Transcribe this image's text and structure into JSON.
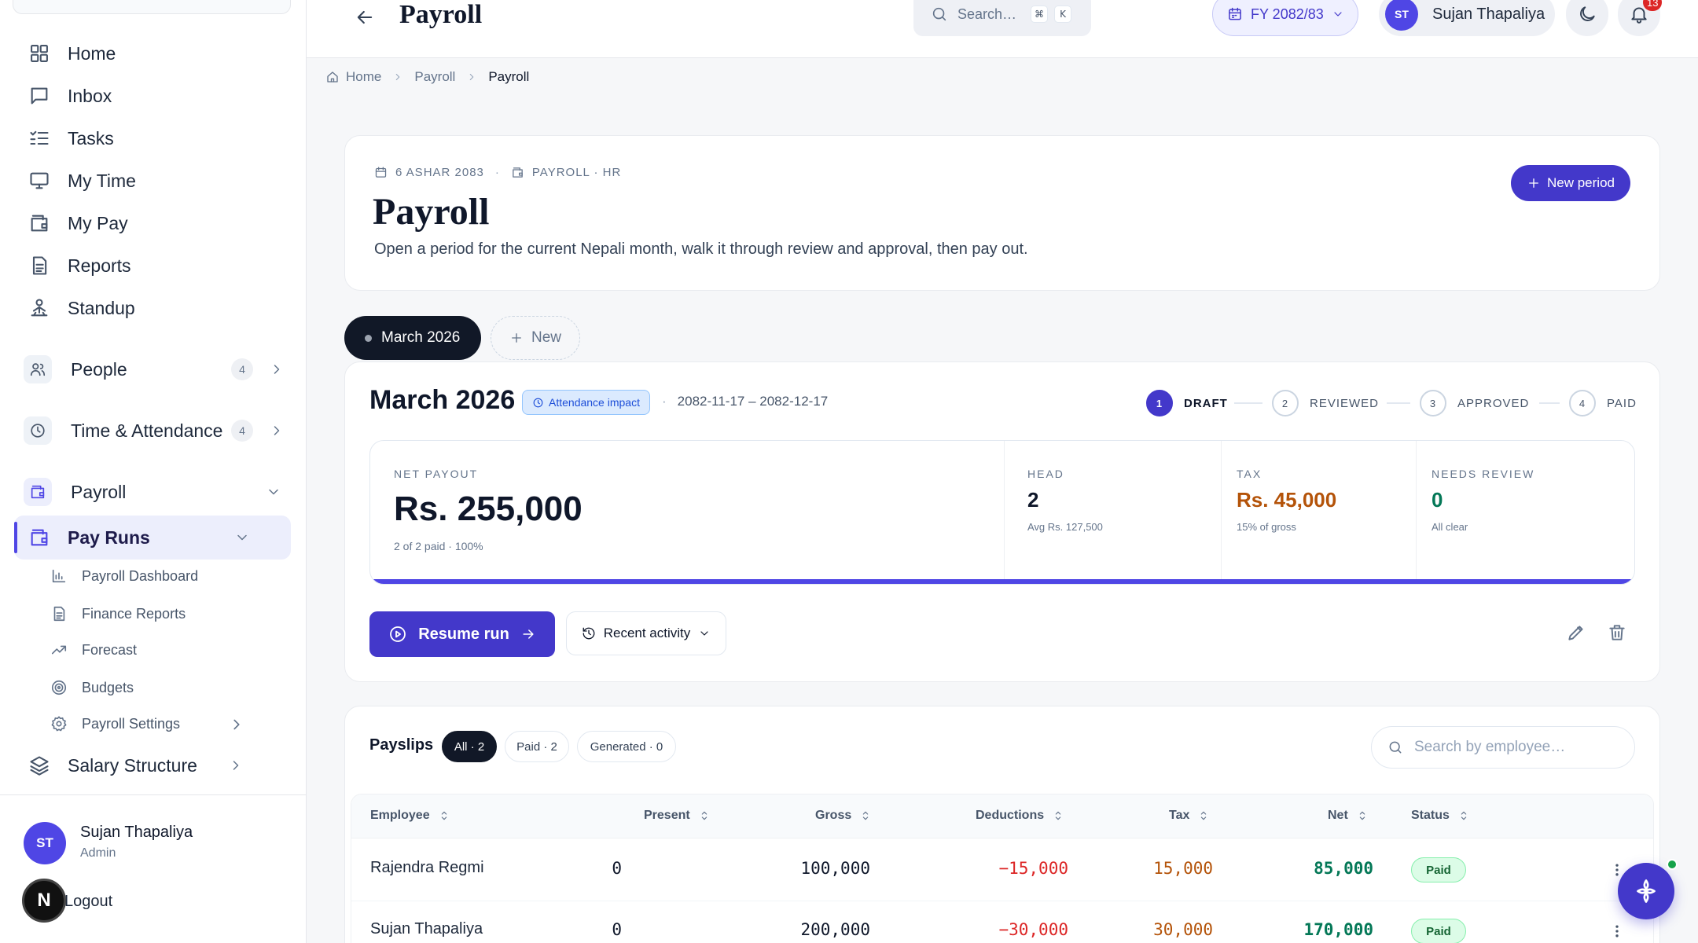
{
  "sidebar": {
    "nav": [
      {
        "label": "Home",
        "icon": "grid-icon"
      },
      {
        "label": "Inbox",
        "icon": "chat-icon"
      },
      {
        "label": "Tasks",
        "icon": "checklist-icon"
      },
      {
        "label": "My Time",
        "icon": "monitor-icon"
      },
      {
        "label": "My Pay",
        "icon": "wallet-icon"
      },
      {
        "label": "Reports",
        "icon": "document-icon"
      },
      {
        "label": "Standup",
        "icon": "person-icon"
      }
    ],
    "people": {
      "label": "People",
      "count": "4"
    },
    "time_attendance": {
      "label": "Time & Attendance",
      "count": "4"
    },
    "payroll": {
      "label": "Payroll"
    },
    "pay_runs": {
      "label": "Pay Runs"
    },
    "sub_items": [
      {
        "label": "Payroll Dashboard"
      },
      {
        "label": "Finance Reports"
      },
      {
        "label": "Forecast"
      },
      {
        "label": "Budgets"
      },
      {
        "label": "Payroll Settings"
      }
    ],
    "salary_structure": {
      "label": "Salary Structure"
    },
    "user": {
      "initials": "ST",
      "name": "Sujan Thapaliya",
      "role": "Admin"
    },
    "n_badge": "N",
    "logout": "Logout"
  },
  "topbar": {
    "title": "Payroll",
    "search": {
      "placeholder": "Search…",
      "kbd1": "⌘",
      "kbd2": "K"
    },
    "fy": "FY 2082/83",
    "user": {
      "initials": "ST",
      "name": "Sujan Thapaliya"
    },
    "notifications": "13"
  },
  "breadcrumb": [
    "Home",
    "Payroll",
    "Payroll"
  ],
  "header": {
    "date": "6 ASHAR 2083",
    "module": "PAYROLL · HR",
    "title": "Payroll",
    "subtitle": "Open a period for the current Nepali month, walk it through review and approval, then pay out.",
    "new_period": "New period"
  },
  "period_tabs": {
    "active": "March 2026",
    "new": "New"
  },
  "run": {
    "title": "March 2026",
    "badge": "Attendance impact",
    "dates": "2082-11-17 – 2082-12-17",
    "steps": [
      {
        "num": "1",
        "label": "DRAFT"
      },
      {
        "num": "2",
        "label": "REVIEWED"
      },
      {
        "num": "3",
        "label": "APPROVED"
      },
      {
        "num": "4",
        "label": "PAID"
      }
    ],
    "current_step": 1,
    "net_payout": {
      "label": "NET PAYOUT",
      "value": "Rs. 255,000",
      "sub": "2 of 2 paid · 100%",
      "progress": 1.0
    },
    "head": {
      "label": "HEAD",
      "value": "2",
      "sub": "Avg Rs. 127,500"
    },
    "tax": {
      "label": "TAX",
      "value": "Rs. 45,000",
      "sub": "15% of gross"
    },
    "needs_review": {
      "label": "NEEDS REVIEW",
      "value": "0",
      "sub": "All clear"
    },
    "resume": "Resume run",
    "recent_activity": "Recent activity"
  },
  "payslips": {
    "title": "Payslips",
    "filters": [
      "All · 2",
      "Paid · 2",
      "Generated · 0"
    ],
    "search_placeholder": "Search by employee…",
    "columns": [
      "Employee",
      "Present",
      "Gross",
      "Deductions",
      "Tax",
      "Net",
      "Status"
    ],
    "rows": [
      {
        "employee": "Rajendra Regmi",
        "present": "0",
        "gross": "100,000",
        "deductions": "−15,000",
        "tax": "15,000",
        "net": "85,000",
        "status": "Paid"
      },
      {
        "employee": "Sujan Thapaliya",
        "present": "0",
        "gross": "200,000",
        "deductions": "−30,000",
        "tax": "30,000",
        "net": "170,000",
        "status": "Paid"
      }
    ]
  },
  "colors": {
    "accent": "#4338ca",
    "deduction": "#dc2626",
    "tax": "#b45309",
    "net": "#047857",
    "paid_bg": "#dcfce7"
  }
}
